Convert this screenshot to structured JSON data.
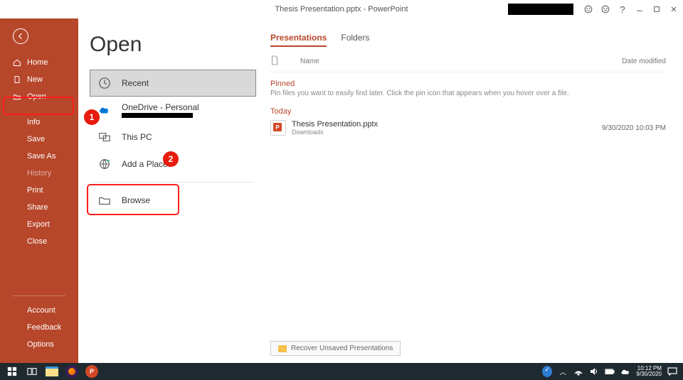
{
  "titlebar": {
    "title": "Thesis Presentation.pptx  -  PowerPoint"
  },
  "sidebar": {
    "home": "Home",
    "new": "New",
    "open": "Open",
    "info": "Info",
    "save": "Save",
    "saveas": "Save As",
    "history": "History",
    "print": "Print",
    "share": "Share",
    "export": "Export",
    "close": "Close",
    "account": "Account",
    "feedback": "Feedback",
    "options": "Options"
  },
  "page": {
    "title": "Open",
    "sources": {
      "recent": "Recent",
      "onedrive": "OneDrive - Personal",
      "thispc": "This PC",
      "addplace": "Add a Place",
      "browse": "Browse"
    },
    "callouts": {
      "one": "1",
      "two": "2"
    }
  },
  "main": {
    "tabs": {
      "presentations": "Presentations",
      "folders": "Folders"
    },
    "header": {
      "name": "Name",
      "date": "Date modified"
    },
    "pinned": {
      "label": "Pinned",
      "hint": "Pin files you want to easily find later. Click the pin icon that appears when you hover over a file."
    },
    "today": {
      "label": "Today"
    },
    "file": {
      "name": "Thesis Presentation.pptx",
      "location": "Downloads",
      "date": "9/30/2020 10:03 PM"
    },
    "recover": "Recover Unsaved Presentations"
  },
  "taskbar": {
    "time": "10:12 PM",
    "date": "9/30/2020"
  }
}
